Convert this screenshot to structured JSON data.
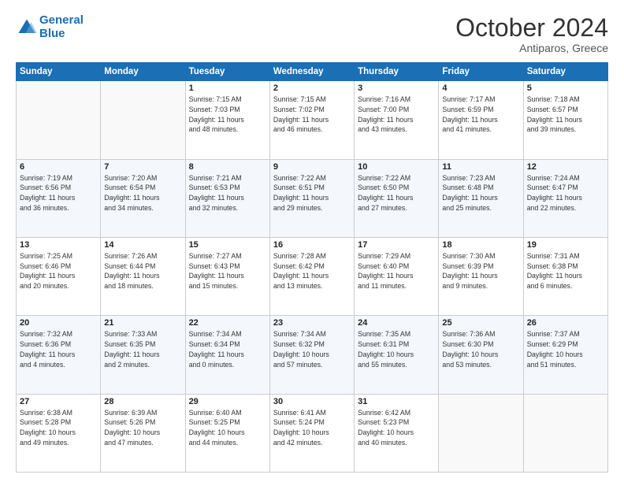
{
  "header": {
    "logo_text_general": "General",
    "logo_text_blue": "Blue",
    "month": "October 2024",
    "location": "Antiparos, Greece"
  },
  "weekdays": [
    "Sunday",
    "Monday",
    "Tuesday",
    "Wednesday",
    "Thursday",
    "Friday",
    "Saturday"
  ],
  "weeks": [
    [
      {
        "day": "",
        "info": ""
      },
      {
        "day": "",
        "info": ""
      },
      {
        "day": "1",
        "info": "Sunrise: 7:15 AM\nSunset: 7:03 PM\nDaylight: 11 hours\nand 48 minutes."
      },
      {
        "day": "2",
        "info": "Sunrise: 7:15 AM\nSunset: 7:02 PM\nDaylight: 11 hours\nand 46 minutes."
      },
      {
        "day": "3",
        "info": "Sunrise: 7:16 AM\nSunset: 7:00 PM\nDaylight: 11 hours\nand 43 minutes."
      },
      {
        "day": "4",
        "info": "Sunrise: 7:17 AM\nSunset: 6:59 PM\nDaylight: 11 hours\nand 41 minutes."
      },
      {
        "day": "5",
        "info": "Sunrise: 7:18 AM\nSunset: 6:57 PM\nDaylight: 11 hours\nand 39 minutes."
      }
    ],
    [
      {
        "day": "6",
        "info": "Sunrise: 7:19 AM\nSunset: 6:56 PM\nDaylight: 11 hours\nand 36 minutes."
      },
      {
        "day": "7",
        "info": "Sunrise: 7:20 AM\nSunset: 6:54 PM\nDaylight: 11 hours\nand 34 minutes."
      },
      {
        "day": "8",
        "info": "Sunrise: 7:21 AM\nSunset: 6:53 PM\nDaylight: 11 hours\nand 32 minutes."
      },
      {
        "day": "9",
        "info": "Sunrise: 7:22 AM\nSunset: 6:51 PM\nDaylight: 11 hours\nand 29 minutes."
      },
      {
        "day": "10",
        "info": "Sunrise: 7:22 AM\nSunset: 6:50 PM\nDaylight: 11 hours\nand 27 minutes."
      },
      {
        "day": "11",
        "info": "Sunrise: 7:23 AM\nSunset: 6:48 PM\nDaylight: 11 hours\nand 25 minutes."
      },
      {
        "day": "12",
        "info": "Sunrise: 7:24 AM\nSunset: 6:47 PM\nDaylight: 11 hours\nand 22 minutes."
      }
    ],
    [
      {
        "day": "13",
        "info": "Sunrise: 7:25 AM\nSunset: 6:46 PM\nDaylight: 11 hours\nand 20 minutes."
      },
      {
        "day": "14",
        "info": "Sunrise: 7:26 AM\nSunset: 6:44 PM\nDaylight: 11 hours\nand 18 minutes."
      },
      {
        "day": "15",
        "info": "Sunrise: 7:27 AM\nSunset: 6:43 PM\nDaylight: 11 hours\nand 15 minutes."
      },
      {
        "day": "16",
        "info": "Sunrise: 7:28 AM\nSunset: 6:42 PM\nDaylight: 11 hours\nand 13 minutes."
      },
      {
        "day": "17",
        "info": "Sunrise: 7:29 AM\nSunset: 6:40 PM\nDaylight: 11 hours\nand 11 minutes."
      },
      {
        "day": "18",
        "info": "Sunrise: 7:30 AM\nSunset: 6:39 PM\nDaylight: 11 hours\nand 9 minutes."
      },
      {
        "day": "19",
        "info": "Sunrise: 7:31 AM\nSunset: 6:38 PM\nDaylight: 11 hours\nand 6 minutes."
      }
    ],
    [
      {
        "day": "20",
        "info": "Sunrise: 7:32 AM\nSunset: 6:36 PM\nDaylight: 11 hours\nand 4 minutes."
      },
      {
        "day": "21",
        "info": "Sunrise: 7:33 AM\nSunset: 6:35 PM\nDaylight: 11 hours\nand 2 minutes."
      },
      {
        "day": "22",
        "info": "Sunrise: 7:34 AM\nSunset: 6:34 PM\nDaylight: 11 hours\nand 0 minutes."
      },
      {
        "day": "23",
        "info": "Sunrise: 7:34 AM\nSunset: 6:32 PM\nDaylight: 10 hours\nand 57 minutes."
      },
      {
        "day": "24",
        "info": "Sunrise: 7:35 AM\nSunset: 6:31 PM\nDaylight: 10 hours\nand 55 minutes."
      },
      {
        "day": "25",
        "info": "Sunrise: 7:36 AM\nSunset: 6:30 PM\nDaylight: 10 hours\nand 53 minutes."
      },
      {
        "day": "26",
        "info": "Sunrise: 7:37 AM\nSunset: 6:29 PM\nDaylight: 10 hours\nand 51 minutes."
      }
    ],
    [
      {
        "day": "27",
        "info": "Sunrise: 6:38 AM\nSunset: 5:28 PM\nDaylight: 10 hours\nand 49 minutes."
      },
      {
        "day": "28",
        "info": "Sunrise: 6:39 AM\nSunset: 5:26 PM\nDaylight: 10 hours\nand 47 minutes."
      },
      {
        "day": "29",
        "info": "Sunrise: 6:40 AM\nSunset: 5:25 PM\nDaylight: 10 hours\nand 44 minutes."
      },
      {
        "day": "30",
        "info": "Sunrise: 6:41 AM\nSunset: 5:24 PM\nDaylight: 10 hours\nand 42 minutes."
      },
      {
        "day": "31",
        "info": "Sunrise: 6:42 AM\nSunset: 5:23 PM\nDaylight: 10 hours\nand 40 minutes."
      },
      {
        "day": "",
        "info": ""
      },
      {
        "day": "",
        "info": ""
      }
    ]
  ]
}
